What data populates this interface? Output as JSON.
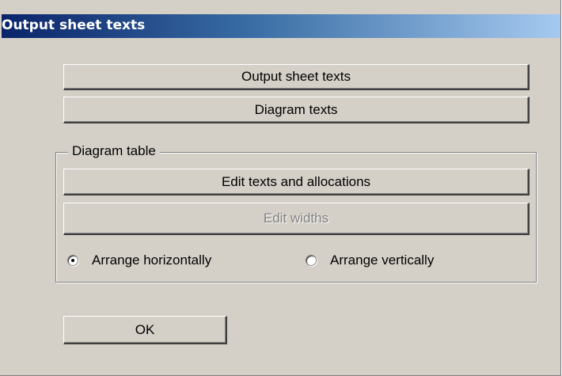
{
  "window": {
    "title": "Output sheet texts"
  },
  "buttons": {
    "output_sheet_texts": "Output sheet texts",
    "diagram_texts": "Diagram texts",
    "ok": "OK"
  },
  "diagram_table": {
    "group_label": "Diagram table",
    "edit_texts_label": "Edit texts and allocations",
    "edit_widths_label": "Edit widths",
    "edit_widths_enabled": false,
    "arrangement": {
      "options": [
        "Arrange horizontally",
        "Arrange vertically"
      ],
      "selected": "Arrange horizontally"
    }
  },
  "colors": {
    "dialog_face": "#d4d0c8",
    "title_gradient_start": "#0a246a",
    "title_gradient_end": "#a6caf0",
    "disabled_text": "#808080"
  },
  "icons": {
    "radio_selected": "radio-selected-icon",
    "radio_unselected": "radio-unselected-icon"
  }
}
